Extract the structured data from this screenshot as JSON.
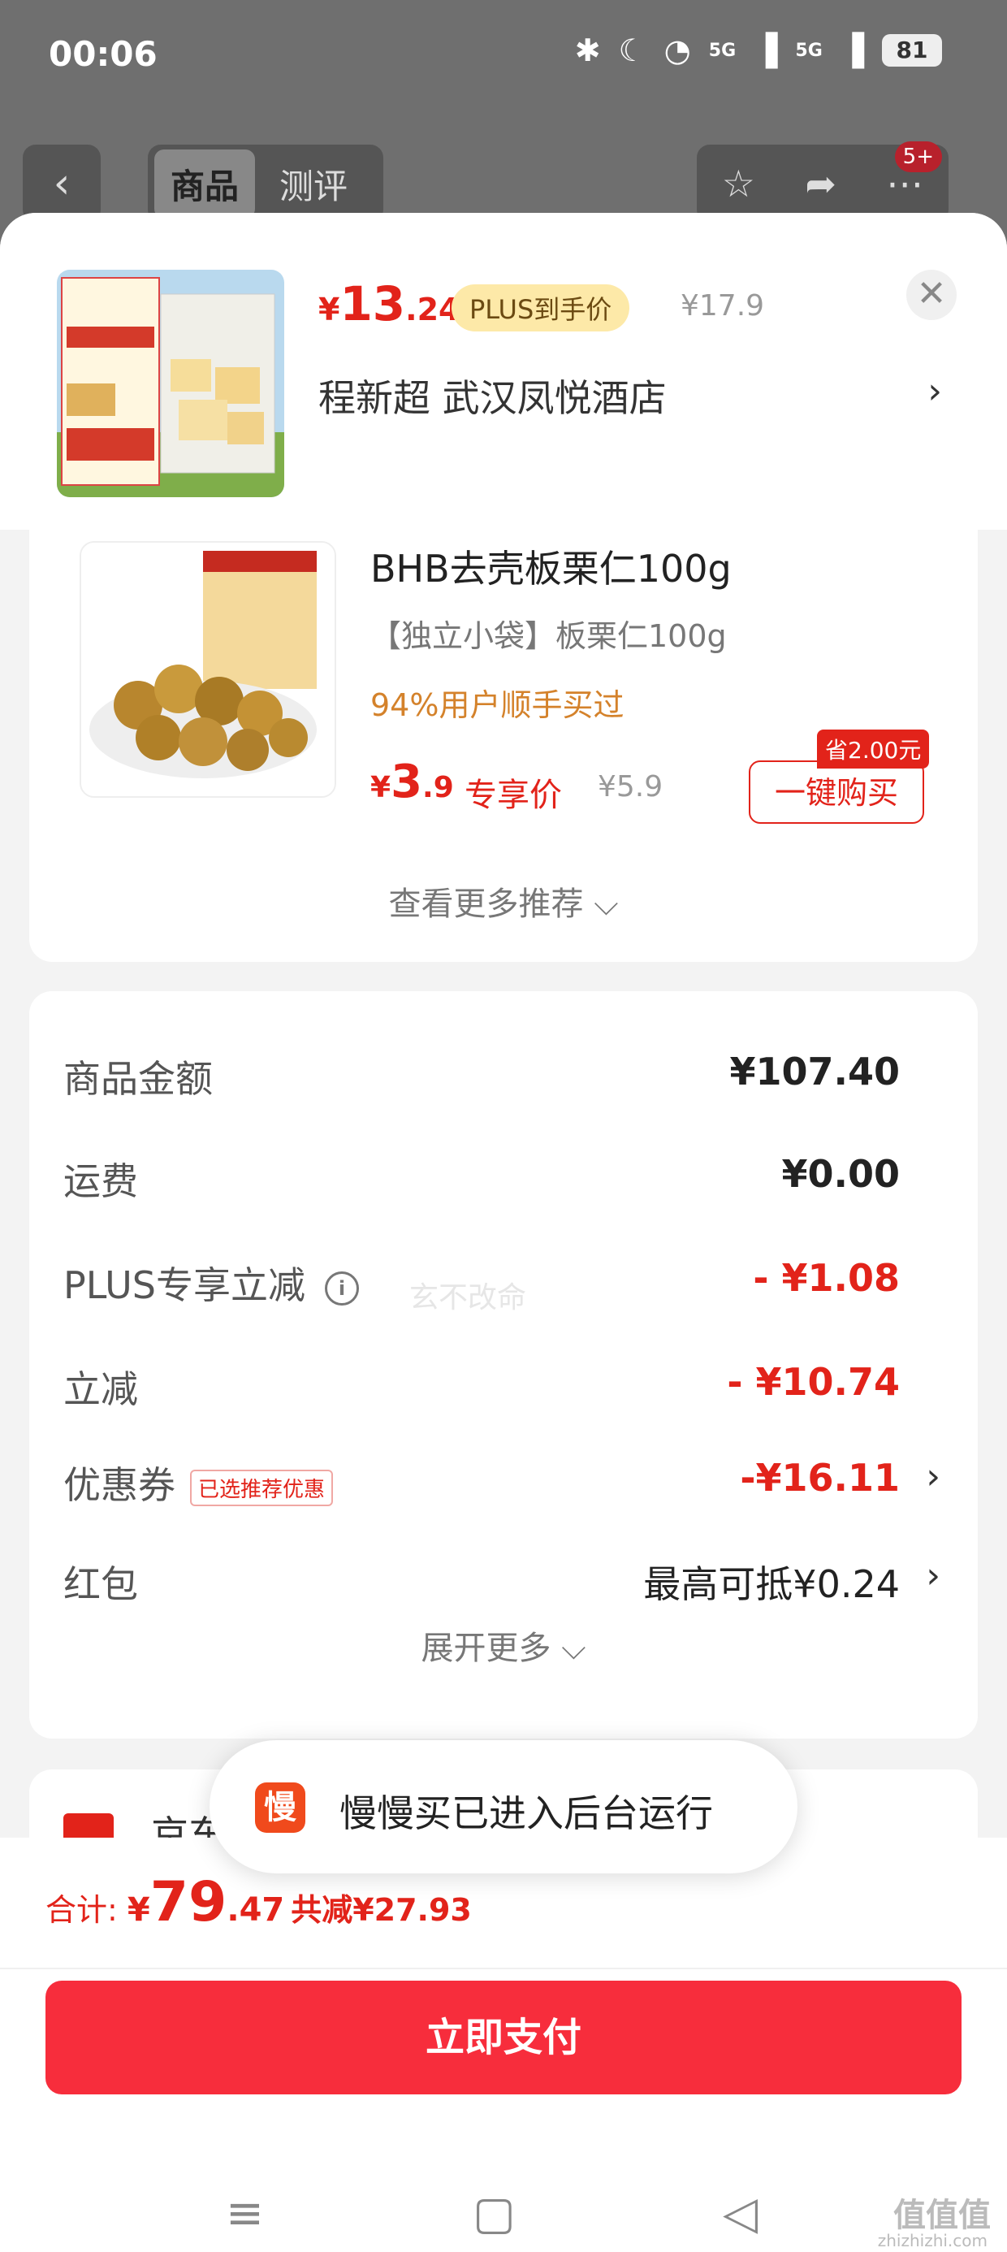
{
  "status_bar": {
    "time": "00:06",
    "signal1": "5G",
    "signal2": "5G",
    "battery": "81"
  },
  "top_nav": {
    "tab_goods": "商品",
    "tab_review": "测评",
    "badge": "5+"
  },
  "product": {
    "price_yen": "¥",
    "price_int": "13",
    "price_dec": ".24",
    "plus_tag": "PLUS到手价",
    "original_price": "¥17.9",
    "address": "程新超  武汉凤悦酒店"
  },
  "recommendation": {
    "title": "BHB去壳板栗仁100g",
    "subtitle": "【独立小袋】板栗仁100g",
    "rate": "94%用户顺手买过",
    "price_yen": "¥",
    "price_int": "3",
    "price_dec": ".9",
    "exclusive": "专享价",
    "original_price": "¥5.9",
    "save_badge": "省2.00元",
    "buy_label": "一键购买",
    "more": "查看更多推荐"
  },
  "costs": {
    "watermark": "玄不改命",
    "rows": [
      {
        "label": "商品金额",
        "value": "¥107.40"
      },
      {
        "label": "运费",
        "value": "¥0.00"
      },
      {
        "label": "PLUS专享立减",
        "value": "- ¥1.08"
      },
      {
        "label": "立减",
        "value": "- ¥10.74"
      },
      {
        "label": "优惠券",
        "tag": "已选推荐优惠",
        "value": "-¥16.11"
      },
      {
        "label": "红包",
        "value": "最高可抵¥0.24"
      }
    ],
    "expand": "展开更多"
  },
  "pay_method": {
    "text": "京东"
  },
  "toast": {
    "icon": "慢",
    "text": "慢慢买已进入后台运行"
  },
  "total": {
    "label": "合计: ",
    "yen": "¥",
    "int": "79",
    "dec": ".47",
    "saved": "共减¥27.93",
    "pay_button": "立即支付"
  },
  "site_mark": {
    "name": "值值值",
    "url": "zhizhizhi.com"
  },
  "colors": {
    "accent": "#e2231a",
    "pay_button": "#f72d3c",
    "plus_tag_bg": "#fde9a8"
  }
}
